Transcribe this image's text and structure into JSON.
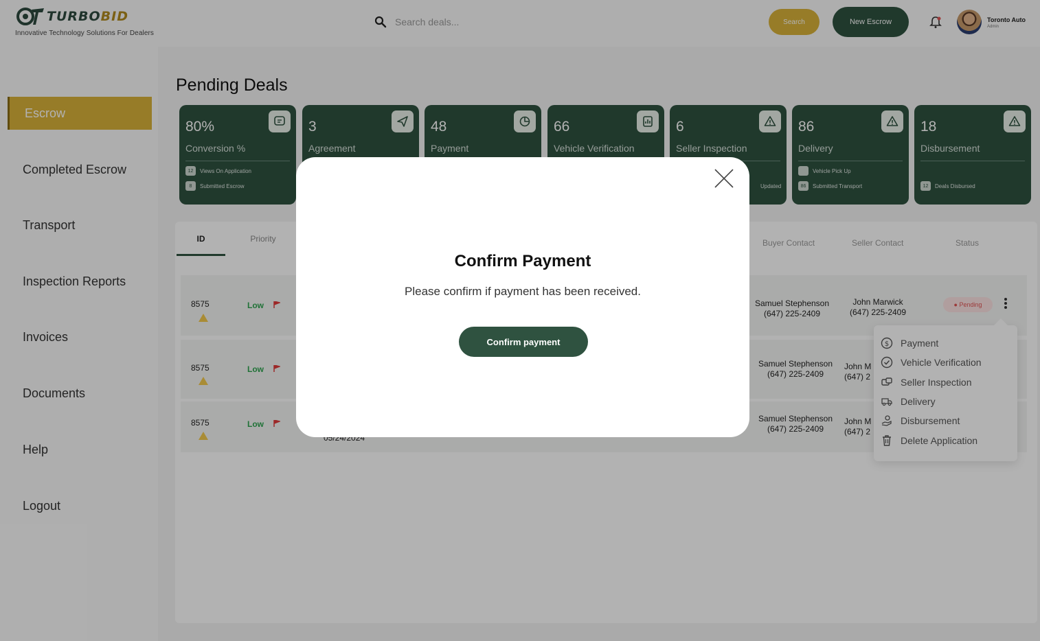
{
  "brand": {
    "name_part1": "TURBO",
    "name_part2": "BID",
    "tagline": "Innovative Technology Solutions For Dealers"
  },
  "header": {
    "search_placeholder": "Search deals...",
    "search_button": "Search",
    "new_escrow_button": "New Escrow",
    "user_name": "Toronto Auto",
    "user_role": "Admin"
  },
  "sidebar": {
    "items": [
      {
        "label": "Escrow",
        "active": true
      },
      {
        "label": "Completed Escrow"
      },
      {
        "label": "Transport"
      },
      {
        "label": "Inspection Reports"
      },
      {
        "label": "Invoices"
      },
      {
        "label": "Documents"
      },
      {
        "label": "Help"
      },
      {
        "label": "Logout"
      }
    ]
  },
  "page": {
    "title": "Pending Deals"
  },
  "stats": [
    {
      "value": "80%",
      "label": "Conversion %",
      "icon": "chat-icon",
      "sub": [
        {
          "badge": "12",
          "text": "Views On Application"
        },
        {
          "badge": "8",
          "text": "Submitted Escrow"
        }
      ]
    },
    {
      "value": "3",
      "label": "Agreement",
      "icon": "send-icon",
      "sub": []
    },
    {
      "value": "48",
      "label": "Payment",
      "icon": "pie-icon",
      "sub": []
    },
    {
      "value": "66",
      "label": "Vehicle Verification",
      "icon": "doc-icon",
      "sub": []
    },
    {
      "value": "6",
      "label": "Seller Inspection",
      "icon": "warning-icon",
      "sub": [
        {
          "badge": "",
          "text": "Updated"
        }
      ]
    },
    {
      "value": "86",
      "label": "Delivery",
      "icon": "warning-icon",
      "sub": [
        {
          "badge": "",
          "text": "Vehicle Pick Up"
        },
        {
          "badge": "86",
          "text": "Submitted Transport"
        }
      ]
    },
    {
      "value": "18",
      "label": "Disbursement",
      "icon": "warning-icon",
      "sub": [
        {
          "badge": "12",
          "text": "Deals Disbursed"
        }
      ]
    }
  ],
  "table": {
    "tabs": [
      "ID",
      "Priority"
    ],
    "columns": [
      "Buyer Contact",
      "Seller Contact",
      "Status"
    ],
    "rows": [
      {
        "id": "8575",
        "priority": "Low",
        "buyer": "Samuel Stephenson",
        "buyer_phone": "(647) 225-2409",
        "seller": "John Marwick",
        "seller_phone": "(647) 225-2409",
        "status": "Pending"
      },
      {
        "id": "8575",
        "priority": "Low",
        "buyer": "Samuel Stephenson",
        "buyer_phone": "(647) 225-2409",
        "seller": "John M",
        "seller_phone": "(647) 2"
      },
      {
        "id": "8575",
        "priority": "Low",
        "buyer": "Samuel Stephenson",
        "buyer_phone": "(647) 225-2409",
        "seller": "John M",
        "seller_phone": "(647) 2",
        "date": "05/24/2024"
      }
    ]
  },
  "row_menu": {
    "items": [
      {
        "label": "Payment",
        "icon": "dollar-icon"
      },
      {
        "label": "Vehicle Verification",
        "icon": "check-circle-icon"
      },
      {
        "label": "Seller Inspection",
        "icon": "car-icon"
      },
      {
        "label": "Delivery",
        "icon": "truck-icon"
      },
      {
        "label": "Disbursement",
        "icon": "hand-coin-icon"
      },
      {
        "label": "Delete Application",
        "icon": "trash-icon"
      }
    ]
  },
  "modal": {
    "title": "Confirm Payment",
    "message": "Please confirm if payment has been received.",
    "confirm_button": "Confirm payment"
  },
  "colors": {
    "primary_green": "#2f5240",
    "accent_gold": "#d8b23a",
    "status_pending": "#e05353",
    "priority_low": "#2ea44f"
  }
}
